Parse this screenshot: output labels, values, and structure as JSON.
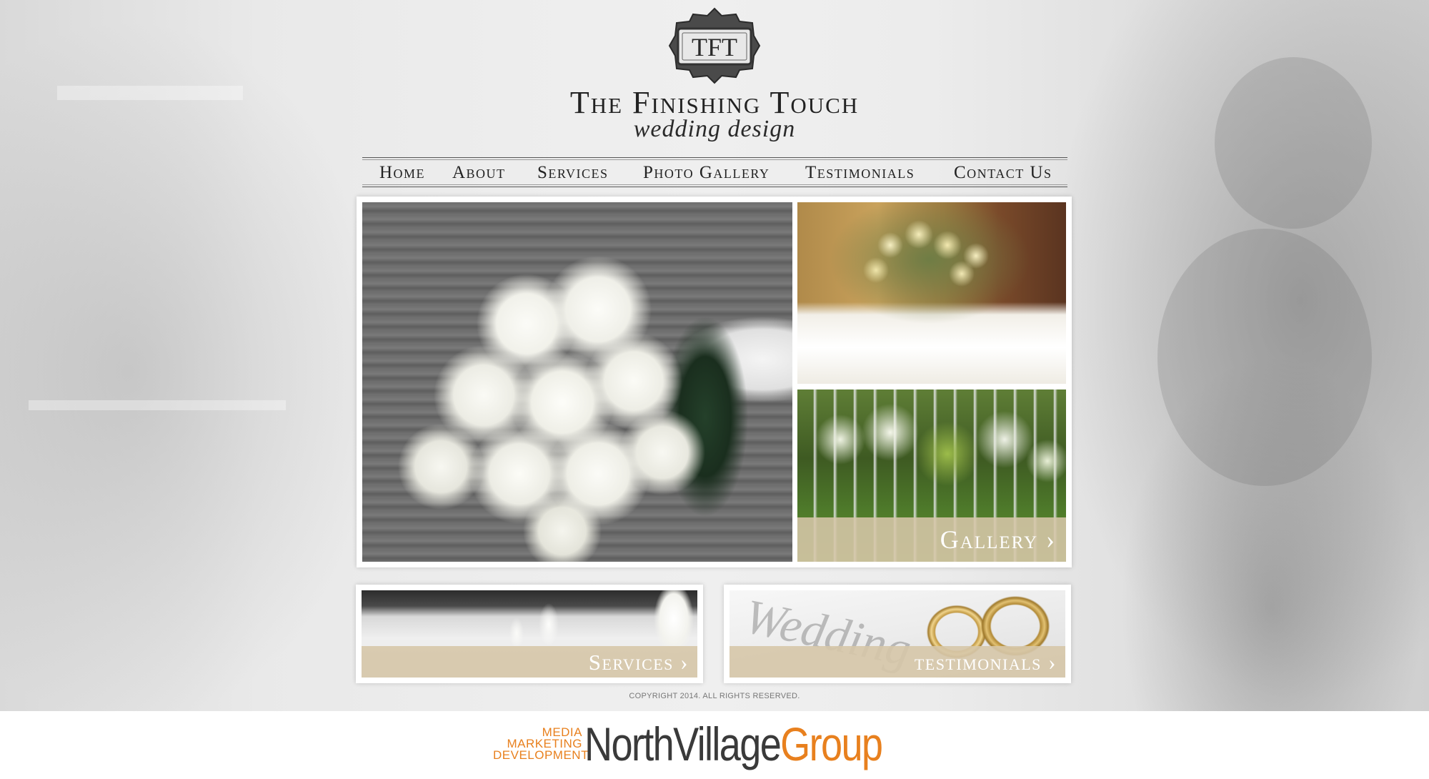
{
  "brand": {
    "emblem_text": "TFT",
    "title": "The Finishing Touch",
    "tagline": "wedding design"
  },
  "nav": {
    "items": [
      {
        "label": "Home"
      },
      {
        "label": "About"
      },
      {
        "label": "Services"
      },
      {
        "label": "Photo Gallery"
      },
      {
        "label": "Testimonials"
      },
      {
        "label": "Contact Us"
      }
    ]
  },
  "gallery": {
    "caption": "Gallery ›"
  },
  "features": {
    "services": "Services ›",
    "testimonials": "testimonials ›",
    "watermark": "Wedding"
  },
  "footer": {
    "copyright": "COPYRIGHT 2014. ALL RIGHTS RESERVED.",
    "agency_tags": [
      "MEDIA",
      "MARKETING",
      "DEVELOPMENT"
    ],
    "agency_name_dark": "NorthVillage",
    "agency_name_orange": "Group"
  },
  "colors": {
    "accent_caption": "#d6c6a8",
    "agency_orange": "#e8801e",
    "text_dark": "#222222"
  }
}
